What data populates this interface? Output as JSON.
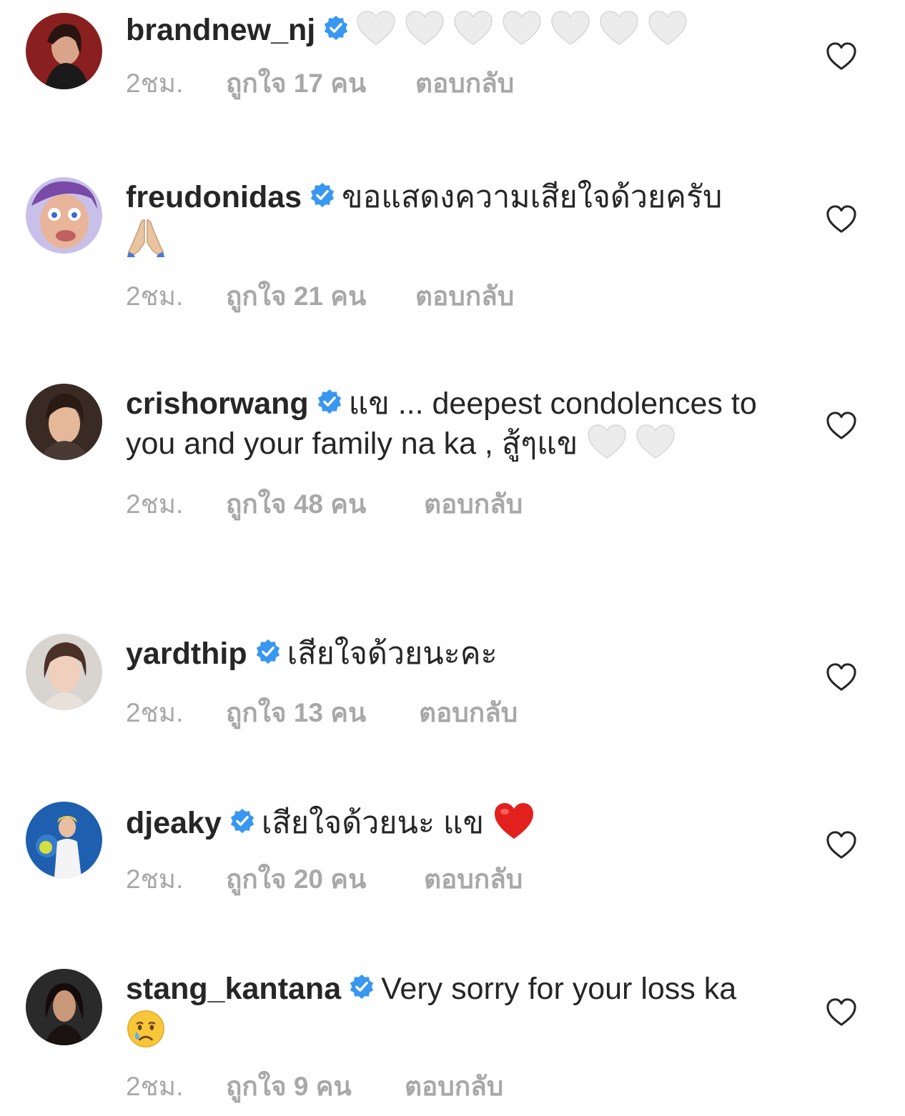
{
  "comments": [
    {
      "username": "brandnew_nj",
      "text": "",
      "time": "2ชม.",
      "likes": "ถูกใจ 17 คน",
      "reply": "ตอบกลับ",
      "avatar_color": "#8a1f1f"
    },
    {
      "username": "freudonidas",
      "text": "ขอแสดงความเสียใจด้วยครับ",
      "time": "2ชม.",
      "likes": "ถูกใจ 21 คน",
      "reply": "ตอบกลับ",
      "avatar_color": "#7a4aa8"
    },
    {
      "username": "crishorwang",
      "text": "แข ... deepest condolences to you and your family na ka , สู้ๆแข",
      "time": "2ชม.",
      "likes": "ถูกใจ 48 คน",
      "reply": "ตอบกลับ",
      "avatar_color": "#3a2a24"
    },
    {
      "username": "yardthip",
      "text": "เสียใจด้วยนะคะ",
      "time": "2ชม.",
      "likes": "ถูกใจ 13 คน",
      "reply": "ตอบกลับ",
      "avatar_color": "#c9c4c0"
    },
    {
      "username": "djeaky",
      "text": "เสียใจด้วยนะ แข",
      "time": "2ชม.",
      "likes": "ถูกใจ 20 คน",
      "reply": "ตอบกลับ",
      "avatar_color": "#1f5fb0"
    },
    {
      "username": "stang_kantana",
      "text": "Very sorry for your loss ka",
      "time": "2ชม.",
      "likes": "ถูกใจ 9 คน",
      "reply": "ตอบกลับ",
      "avatar_color": "#2a2a2a"
    }
  ],
  "icons": {
    "verified": "verified-badge-icon",
    "like": "heart-outline-icon",
    "white_heart": "white-heart-emoji",
    "red_heart": "red-heart-emoji",
    "folded_hands": "folded-hands-emoji",
    "crying_face": "crying-face-emoji"
  },
  "colors": {
    "text": "#262626",
    "meta": "#a8a8a8",
    "verified": "#3897f0"
  }
}
